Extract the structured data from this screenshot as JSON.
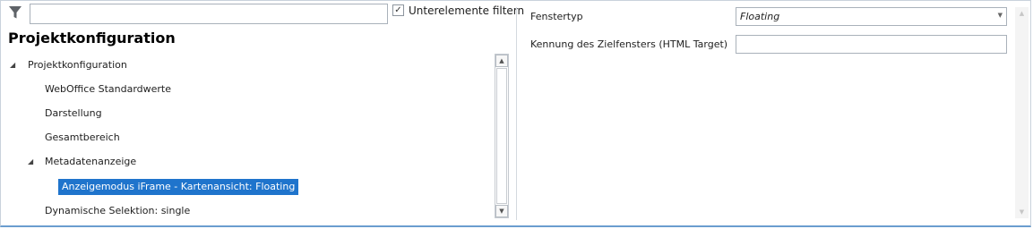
{
  "filter": {
    "icon": "funnel-filter-icon",
    "search_value": "",
    "subelements_checked": true,
    "subelements_label": "Unterelemente filtern"
  },
  "tree": {
    "title": "Projektkonfiguration",
    "nodes": [
      {
        "label": "Projektkonfiguration",
        "expanded": true
      },
      {
        "label": "WebOffice Standardwerte"
      },
      {
        "label": "Darstellung"
      },
      {
        "label": "Gesamtbereich"
      },
      {
        "label": "Metadatenanzeige",
        "expanded": true
      },
      {
        "label": "Anzeigemodus iFrame - Kartenansicht: Floating",
        "selected": true
      },
      {
        "label": "Dynamische Selektion: single"
      }
    ]
  },
  "properties": {
    "window_type": {
      "label": "Fenstertyp",
      "value": "Floating"
    },
    "target_id": {
      "label": "Kennung des Zielfensters (HTML Target)",
      "value": ""
    }
  },
  "colors": {
    "selection": "#1f74cc",
    "bottom_accent": "#6a9dcf",
    "border": "#a9b1ba"
  }
}
